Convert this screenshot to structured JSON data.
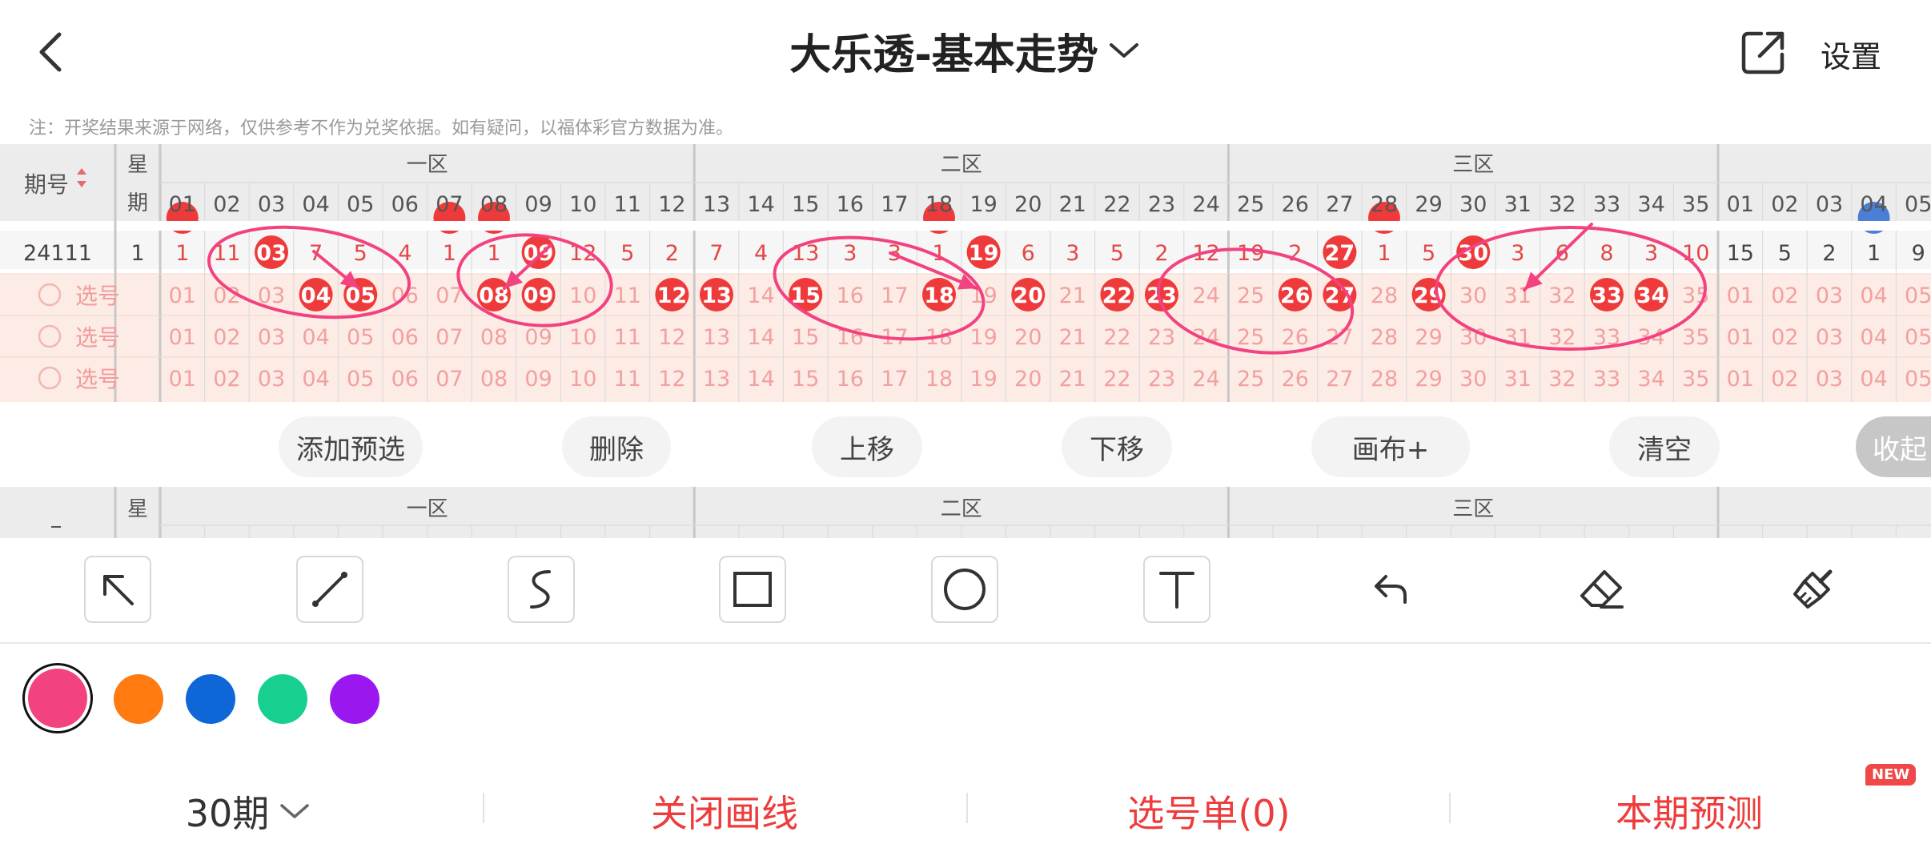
{
  "header": {
    "title": "大乐透-基本走势",
    "settings_label": "设置"
  },
  "note": "注：开奖结果来源于网络，仅供参考不作为兑奖依据。如有疑问，以福体彩官方数据为准。",
  "table": {
    "issue_header": "期号",
    "week_header": "星期",
    "week_header_top": "星",
    "week_header_bottom": "期",
    "zones": [
      "一区",
      "二区",
      "三区"
    ],
    "front_numbers": [
      "01",
      "02",
      "03",
      "04",
      "05",
      "06",
      "07",
      "08",
      "09",
      "10",
      "11",
      "12",
      "13",
      "14",
      "15",
      "16",
      "17",
      "18",
      "19",
      "20",
      "21",
      "22",
      "23",
      "24",
      "25",
      "26",
      "27",
      "28",
      "29",
      "30",
      "31",
      "32",
      "33",
      "34",
      "35"
    ],
    "back_numbers": [
      "01",
      "02",
      "03",
      "04",
      "05"
    ],
    "draw_row": {
      "issue": "24111",
      "weekday": "1",
      "front_cells": [
        "1",
        "11",
        "03",
        "7",
        "5",
        "4",
        "1",
        "1",
        "09",
        "12",
        "5",
        "2",
        "7",
        "4",
        "13",
        "3",
        "3",
        "1",
        "19",
        "6",
        "3",
        "5",
        "2",
        "12",
        "19",
        "2",
        "27",
        "1",
        "5",
        "30",
        "3",
        "6",
        "8",
        "3",
        "10"
      ],
      "front_hits": [
        "03",
        "09",
        "19",
        "27",
        "30"
      ],
      "back_cells": [
        "15",
        "5",
        "2",
        "1",
        "9"
      ]
    },
    "pick_rows": [
      {
        "label": "选号",
        "selected": [
          "04",
          "05",
          "08",
          "09",
          "12",
          "13",
          "15",
          "18",
          "20",
          "22",
          "23",
          "26",
          "27",
          "29",
          "33",
          "34"
        ]
      },
      {
        "label": "选号",
        "selected": []
      },
      {
        "label": "选号",
        "selected": []
      }
    ]
  },
  "actions": {
    "add": "添加预选",
    "delete": "删除",
    "up": "上移",
    "down": "下移",
    "canvas": "画布+",
    "clear": "清空",
    "collapse": "收起"
  },
  "tools": [
    "arrow-tool-icon",
    "line-tool-icon",
    "curve-tool-icon",
    "rectangle-tool-icon",
    "circle-tool-icon",
    "text-tool-icon",
    "undo-icon",
    "eraser-icon",
    "clear-brush-icon"
  ],
  "colors": {
    "selected": "#f2427f",
    "palette": [
      "#f2427f",
      "#ff7a10",
      "#0f66d6",
      "#17d08f",
      "#9b17f0"
    ],
    "hit": "#ee3a3a",
    "pick_bg": "#fdece6",
    "pick_text": "#f2a0a0",
    "draw_text": "#e24848"
  },
  "footer": {
    "periods": "30期",
    "close_draw": "关闭画线",
    "selection_list": "选号单(0)",
    "prediction": "本期预测",
    "new_badge": "NEW"
  }
}
